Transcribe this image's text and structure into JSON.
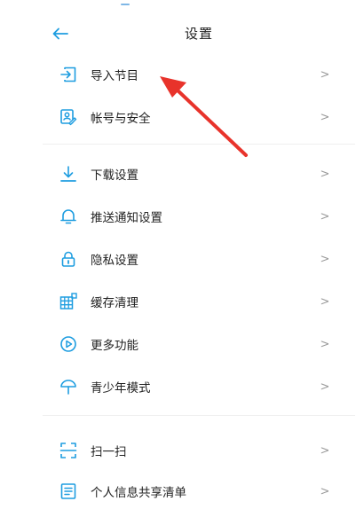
{
  "header": {
    "title": "设置",
    "back_icon": "arrow-left-icon"
  },
  "colors": {
    "accent": "#1e9de0",
    "annotation_arrow": "#e8332b"
  },
  "groups": [
    {
      "items": [
        {
          "label": "导入节目",
          "icon": "import-icon",
          "chevron": ">"
        },
        {
          "label": "帐号与安全",
          "icon": "account-security-icon",
          "chevron": ">"
        }
      ]
    },
    {
      "items": [
        {
          "label": "下载设置",
          "icon": "download-icon",
          "chevron": ">"
        },
        {
          "label": "推送通知设置",
          "icon": "bell-icon",
          "chevron": ">"
        },
        {
          "label": "隐私设置",
          "icon": "lock-icon",
          "chevron": ">"
        },
        {
          "label": "缓存清理",
          "icon": "cache-grid-icon",
          "chevron": ">"
        },
        {
          "label": "更多功能",
          "icon": "play-circle-icon",
          "chevron": ">"
        },
        {
          "label": "青少年模式",
          "icon": "umbrella-icon",
          "chevron": ">"
        }
      ]
    },
    {
      "items": [
        {
          "label": "扫一扫",
          "icon": "scan-icon",
          "chevron": ">"
        },
        {
          "label": "个人信息共享清单",
          "icon": "info-list-icon",
          "chevron": ">"
        }
      ]
    }
  ]
}
